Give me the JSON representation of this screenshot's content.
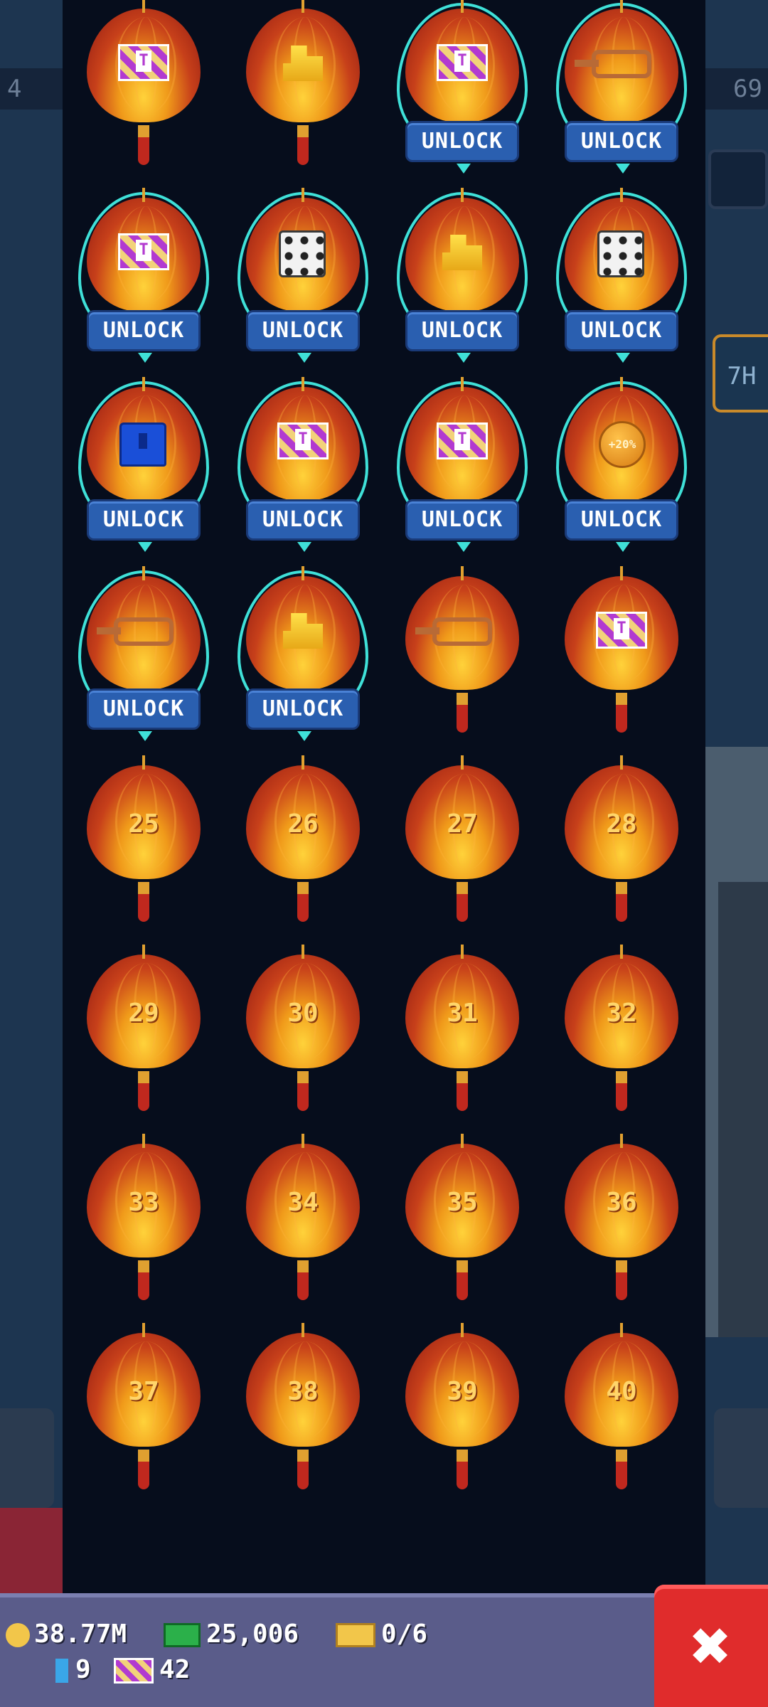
{
  "background": {
    "left_strip_text": "4",
    "right_strip_text": "69",
    "right_tab_text": "7H"
  },
  "unlock_label": "UNLOCK",
  "rows": [
    [
      {
        "icon": "ticket-icon",
        "unlock": false
      },
      {
        "icon": "coins-icon",
        "unlock": false
      },
      {
        "icon": "ticket-icon",
        "unlock": true
      },
      {
        "icon": "key-icon",
        "unlock": true
      }
    ],
    [
      {
        "icon": "ticket-icon",
        "unlock": true
      },
      {
        "icon": "dice-icon",
        "unlock": true
      },
      {
        "icon": "coins-icon",
        "unlock": true
      },
      {
        "icon": "dice-icon",
        "unlock": true
      }
    ],
    [
      {
        "icon": "chest-icon",
        "unlock": true
      },
      {
        "icon": "ticket-icon",
        "unlock": true
      },
      {
        "icon": "ticket-icon",
        "unlock": true
      },
      {
        "icon": "medal-icon",
        "unlock": true,
        "text": "+20%"
      }
    ],
    [
      {
        "icon": "key-icon",
        "unlock": true
      },
      {
        "icon": "coins-icon",
        "unlock": true
      },
      {
        "icon": "key-icon",
        "unlock": false
      },
      {
        "icon": "ticket-icon",
        "unlock": false
      }
    ],
    [
      {
        "num": "25"
      },
      {
        "num": "26"
      },
      {
        "num": "27"
      },
      {
        "num": "28"
      }
    ],
    [
      {
        "num": "29"
      },
      {
        "num": "30"
      },
      {
        "num": "31"
      },
      {
        "num": "32"
      }
    ],
    [
      {
        "num": "33"
      },
      {
        "num": "34"
      },
      {
        "num": "35"
      },
      {
        "num": "36"
      }
    ],
    [
      {
        "num": "37"
      },
      {
        "num": "38"
      },
      {
        "num": "39"
      },
      {
        "num": "40"
      }
    ]
  ],
  "currency": {
    "coins": "38.77M",
    "cash": "25,006",
    "gold": "0/6",
    "gems": "9",
    "tickets": "42"
  },
  "close_label": "✖"
}
